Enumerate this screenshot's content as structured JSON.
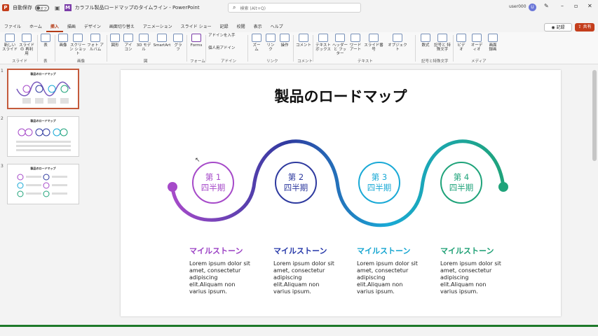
{
  "titlebar": {
    "autosave_label": "自動保存",
    "autosave_state": "オフ",
    "document": "カラフル製品ロードマップのタイムライン  -  PowerPoint",
    "search_placeholder": "検索 (Alt+Q)",
    "user": "user000",
    "avatar_initial": "U"
  },
  "menu": {
    "tabs": [
      "ファイル",
      "ホーム",
      "挿入",
      "描画",
      "デザイン",
      "画面切り替え",
      "アニメーション",
      "スライド ショー",
      "記録",
      "校閲",
      "表示",
      "ヘルプ"
    ],
    "active": "挿入",
    "record_label": "記録",
    "share_label": "共有"
  },
  "ribbon": {
    "buttons": [
      "新しい スライド",
      "スライドの 再利用",
      "表",
      "画像",
      "スクリーン ショット",
      "フォト アルバム",
      "図形",
      "アイ コン",
      "3D モデル",
      "SmartArt",
      "グラフ",
      "Forms",
      "アドインを入手",
      "個人用アドイン",
      "ズーム",
      "リンク",
      "操作",
      "コメント",
      "テキスト ボックス",
      "ヘッダーと フッター",
      "ワード アート",
      "スライド番号",
      "オブジェクト",
      "数式",
      "記号と 特殊文字",
      "ビデオ",
      "オーディオ",
      "画面 録画"
    ],
    "groups": [
      "スライド",
      "表",
      "画像",
      "図",
      "フォーム",
      "アドイン",
      "リンク",
      "コメント",
      "テキスト",
      "記号と特殊文字",
      "メディア"
    ]
  },
  "thumbnails": [
    {
      "num": "1",
      "title": "製品のロードマップ"
    },
    {
      "num": "2",
      "title": "製品のロードマップ"
    },
    {
      "num": "3",
      "title": "製品のロードマップ"
    }
  ],
  "slide": {
    "title": "製品のロードマップ",
    "quarters": [
      {
        "line1": "第 1",
        "line2": "四半期",
        "color": "#a64ac9"
      },
      {
        "line1": "第 2",
        "line2": "四半期",
        "color": "#2e3a9f"
      },
      {
        "line1": "第 3",
        "line2": "四半期",
        "color": "#19a9d6"
      },
      {
        "line1": "第 4",
        "line2": "四半期",
        "color": "#1fa37a"
      }
    ],
    "milestones": [
      {
        "heading": "マイルストーン",
        "body": "Lorem ipsum dolor sit\namet, consectetur\nadipiscing\nelit.Aliquam non\nvarius ipsum.",
        "color": "#9a3fc4"
      },
      {
        "heading": "マイルストーン",
        "body": "Lorem ipsum dolor sit\namet, consectetur\nadipiscing\nelit.Aliquam non\nvarius ipsum.",
        "color": "#2436a8"
      },
      {
        "heading": "マイルストーン",
        "body": "Lorem ipsum dolor sit\namet, consectetur\nadipiscing\nelit.Aliquam non\nvarius ipsum.",
        "color": "#12a4d0"
      },
      {
        "heading": "マイルストーン",
        "body": "Lorem ipsum dolor sit\namet, consectetur\nadipiscing\nelit.Aliquam non\nvarius ipsum.",
        "color": "#1a9e72"
      }
    ]
  }
}
